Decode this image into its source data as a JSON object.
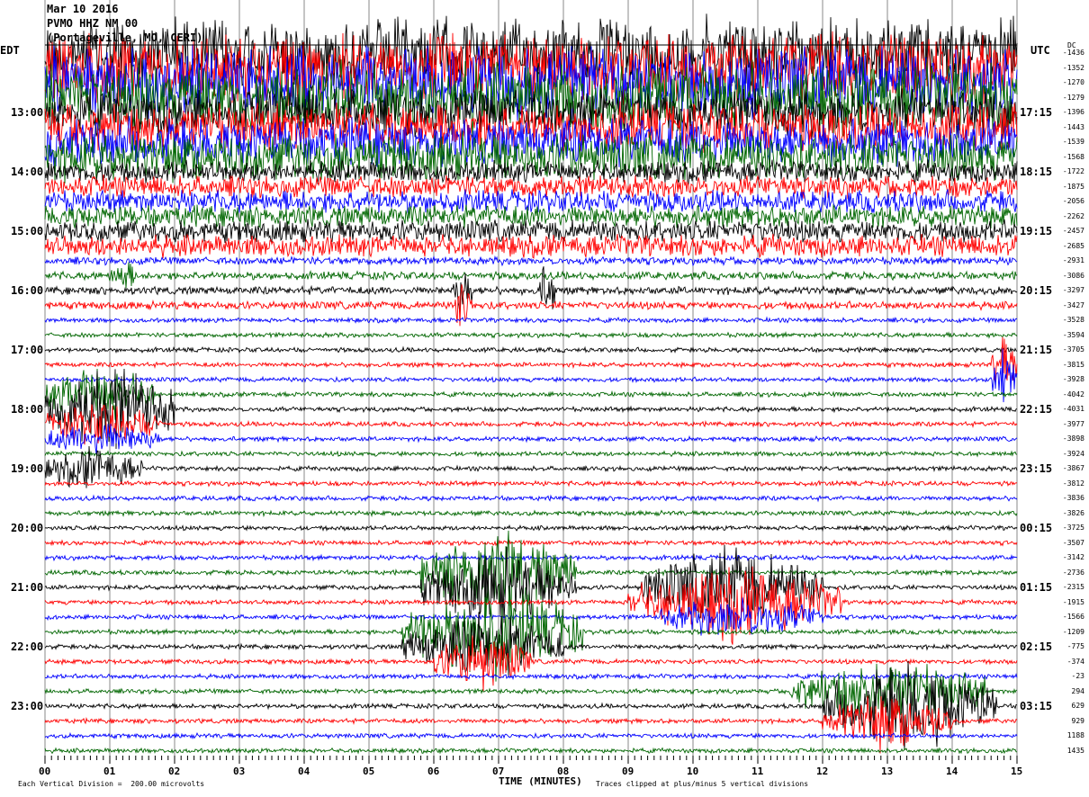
{
  "chart_data": {
    "type": "line",
    "title_lines": [
      "Mar 10 2016",
      "PVMO HHZ NM 00",
      "(Portageville, MO, CERI)"
    ],
    "left_axis_label": "EDT",
    "right_axis_label": "UTC",
    "dc_label": "DC",
    "left_hour_labels": [
      "13:00",
      "14:00",
      "15:00",
      "16:00",
      "17:00",
      "18:00",
      "19:00",
      "20:00",
      "21:00",
      "22:00",
      "23:00"
    ],
    "right_hour_labels": [
      "17:15",
      "18:15",
      "19:15",
      "20:15",
      "21:15",
      "22:15",
      "23:15",
      "00:15",
      "01:15",
      "02:15",
      "03:15"
    ],
    "dc_offsets": [
      -1436,
      -1352,
      -1270,
      -1279,
      -1396,
      -1443,
      -1539,
      -1568,
      -1722,
      -1875,
      -2056,
      -2262,
      -2457,
      -2685,
      -2931,
      -3086,
      -3297,
      -3427,
      -3528,
      -3594,
      -3705,
      -3815,
      -3928,
      -4042,
      -4031,
      -3977,
      -3898,
      -3924,
      -3867,
      -3812,
      -3836,
      -3826,
      -3725,
      -3507,
      -3142,
      -2736,
      -2315,
      -1915,
      -1566,
      -1209,
      -775,
      -374,
      -23,
      294,
      629,
      929,
      1188,
      1435
    ],
    "x_tick_labels": [
      "00",
      "01",
      "02",
      "03",
      "04",
      "05",
      "06",
      "07",
      "08",
      "09",
      "10",
      "11",
      "12",
      "13",
      "14",
      "15"
    ],
    "xlabel": "TIME (MINUTES)",
    "xlim": [
      0,
      15
    ],
    "scale_note": "Each Vertical Division =  200.00 microvolts",
    "clip_note": "Traces clipped at plus/minus 5 vertical divisions",
    "trace_colors": [
      "#000000",
      "#ff0000",
      "#0000ff",
      "#006600"
    ],
    "grid": true
  }
}
